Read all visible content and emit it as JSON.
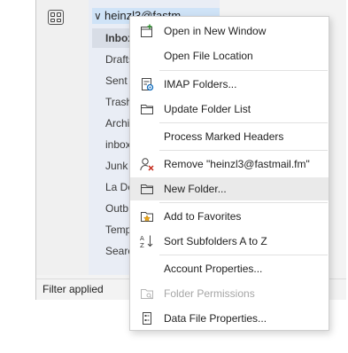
{
  "window": {
    "account_name": "heinzl3@fastm",
    "folders": [
      "Inbox",
      "Drafts",
      "Sent",
      "Trash",
      "Archi",
      "inbox",
      "Junk",
      "La De",
      "Outb",
      "Temp",
      "Searc"
    ],
    "status_text": "Filter applied"
  },
  "menu": {
    "items": [
      {
        "label": "Open in New Window",
        "icon": "new-window-icon"
      },
      {
        "label": "Open File Location",
        "icon": ""
      },
      {
        "label": "IMAP Folders...",
        "icon": "imap-folders-icon"
      },
      {
        "label": "Update Folder List",
        "icon": "folder-icon"
      },
      {
        "label": "Process Marked Headers",
        "icon": ""
      },
      {
        "label": "Remove \"heinzl3@fastmail.fm\"",
        "icon": "remove-account-icon"
      },
      {
        "label": "New Folder...",
        "icon": "new-folder-icon"
      },
      {
        "label": "Add to Favorites",
        "icon": "favorites-icon"
      },
      {
        "label": "Sort Subfolders A to Z",
        "icon": "sort-az-icon"
      },
      {
        "label": "Account Properties...",
        "icon": ""
      },
      {
        "label": "Folder Permissions",
        "icon": "folder-permissions-icon",
        "disabled": true
      },
      {
        "label": "Data File Properties...",
        "icon": "data-file-properties-icon"
      }
    ]
  },
  "colors": {
    "accent": "#0f6cbd",
    "remove_red": "#c42b1c",
    "star": "#e8a317"
  }
}
